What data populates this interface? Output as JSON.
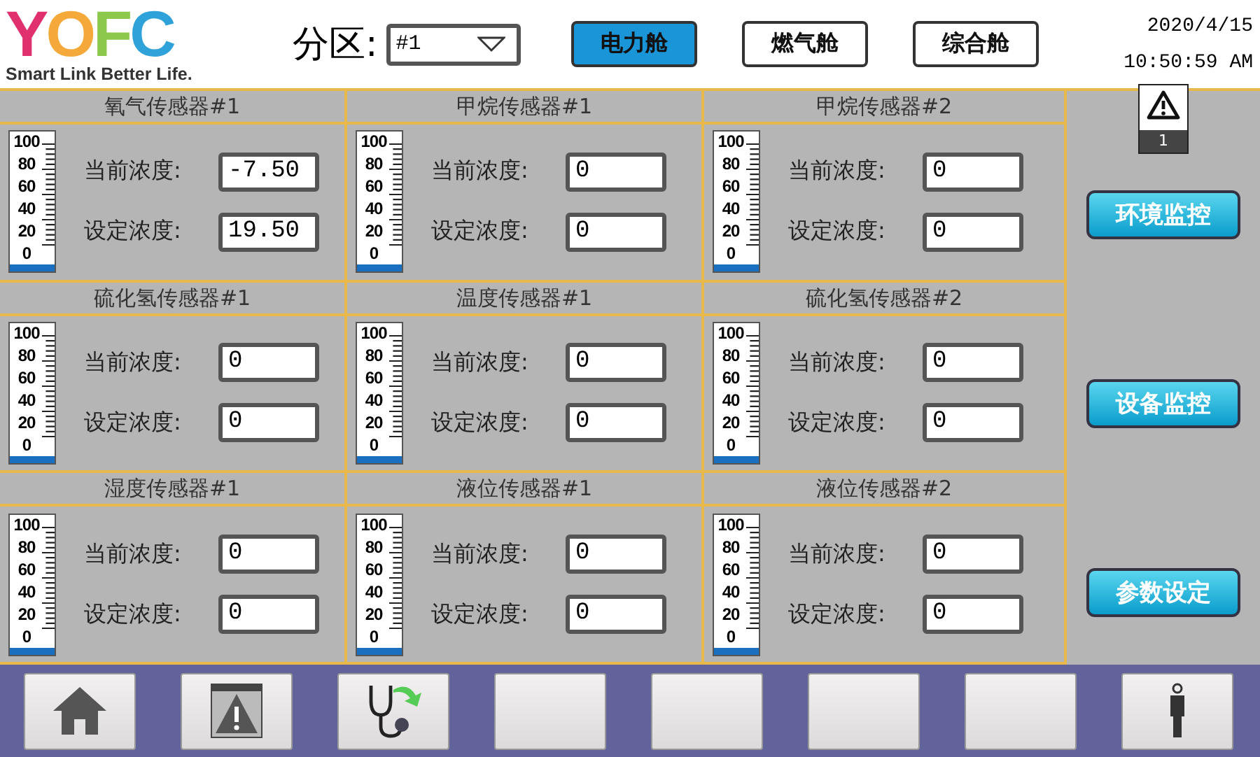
{
  "logo": {
    "letters": [
      {
        "char": "Y",
        "color": "#e0306e"
      },
      {
        "char": "O",
        "color": "#f4a93a"
      },
      {
        "char": "F",
        "color": "#8cc84b"
      },
      {
        "char": "C",
        "color": "#2fa3d9"
      }
    ],
    "tagline": "Smart Link Better Life."
  },
  "partition": {
    "label": "分区:",
    "value": "#1"
  },
  "cabins": [
    {
      "label": "电力舱",
      "selected": true
    },
    {
      "label": "燃气舱",
      "selected": false
    },
    {
      "label": "综合舱",
      "selected": false
    }
  ],
  "datetime": {
    "date": "2020/4/15",
    "time": "10:50:59 AM"
  },
  "alarm": {
    "count": "1"
  },
  "sensors": [
    {
      "title": "氧气传感器#1",
      "scale": [
        "100",
        "80",
        "60",
        "40",
        "20",
        "0"
      ],
      "level": 0,
      "current_label": "当前浓度:",
      "current": "-7.50",
      "set_label": "设定浓度:",
      "set": "19.50"
    },
    {
      "title": "甲烷传感器#1",
      "scale": [
        "100",
        "80",
        "60",
        "40",
        "20",
        "0"
      ],
      "level": 0,
      "current_label": "当前浓度:",
      "current": "0",
      "set_label": "设定浓度:",
      "set": "0"
    },
    {
      "title": "甲烷传感器#2",
      "scale": [
        "100",
        "80",
        "60",
        "40",
        "20",
        "0"
      ],
      "level": 0,
      "current_label": "当前浓度:",
      "current": "0",
      "set_label": "设定浓度:",
      "set": "0"
    },
    {
      "title": "硫化氢传感器#1",
      "scale": [
        "100",
        "80",
        "60",
        "40",
        "20",
        "0"
      ],
      "level": 0,
      "current_label": "当前浓度:",
      "current": "0",
      "set_label": "设定浓度:",
      "set": "0"
    },
    {
      "title": "温度传感器#1",
      "scale": [
        "100",
        "80",
        "60",
        "40",
        "20",
        "0"
      ],
      "level": 0,
      "current_label": "当前浓度:",
      "current": "0",
      "set_label": "设定浓度:",
      "set": "0"
    },
    {
      "title": "硫化氢传感器#2",
      "scale": [
        "100",
        "80",
        "60",
        "40",
        "20",
        "0"
      ],
      "level": 0,
      "current_label": "当前浓度:",
      "current": "0",
      "set_label": "设定浓度:",
      "set": "0"
    },
    {
      "title": "湿度传感器#1",
      "scale": [
        "100",
        "80",
        "60",
        "40",
        "20",
        "0"
      ],
      "level": 0,
      "current_label": "当前浓度:",
      "current": "0",
      "set_label": "设定浓度:",
      "set": "0"
    },
    {
      "title": "液位传感器#1",
      "scale": [
        "100",
        "80",
        "60",
        "40",
        "20",
        "0"
      ],
      "level": 0,
      "current_label": "当前浓度:",
      "current": "0",
      "set_label": "设定浓度:",
      "set": "0"
    },
    {
      "title": "液位传感器#2",
      "scale": [
        "100",
        "80",
        "60",
        "40",
        "20",
        "0"
      ],
      "level": 0,
      "current_label": "当前浓度:",
      "current": "0",
      "set_label": "设定浓度:",
      "set": "0"
    }
  ],
  "side_buttons": [
    "环境监控",
    "设备监控",
    "参数设定"
  ],
  "toolbar": [
    {
      "kind": "home"
    },
    {
      "kind": "alarm"
    },
    {
      "kind": "diagnosis"
    },
    {
      "kind": "blank"
    },
    {
      "kind": "blank"
    },
    {
      "kind": "blank"
    },
    {
      "kind": "blank"
    },
    {
      "kind": "person"
    }
  ]
}
